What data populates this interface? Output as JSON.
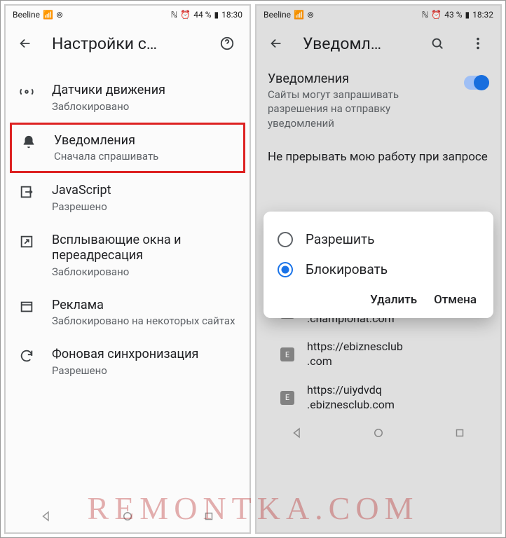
{
  "left": {
    "status": {
      "carrier": "Beeline",
      "battery": "44 %",
      "time": "18:30"
    },
    "appbar": {
      "title": "Настройки с…"
    },
    "items": [
      {
        "title": "Датчики движения",
        "sub": "Заблокировано"
      },
      {
        "title": "Уведомления",
        "sub": "Сначала спрашивать"
      },
      {
        "title": "JavaScript",
        "sub": "Разрешено"
      },
      {
        "title": "Всплывающие окна и переадресация",
        "sub": "Заблокировано"
      },
      {
        "title": "Реклама",
        "sub": "Заблокировано на некоторых сайтах"
      },
      {
        "title": "Фоновая синхронизация",
        "sub": "Разрешено"
      }
    ]
  },
  "right": {
    "status": {
      "carrier": "Beeline",
      "battery": "43 %",
      "time": "18:32"
    },
    "appbar": {
      "title": "Уведомл…"
    },
    "section": {
      "title": "Уведомления",
      "sub": "Сайты могут запрашивать разрешения на отправку уведомлений",
      "header2": "Не прерывать мою работу при запросе"
    },
    "dialog": {
      "opt_allow": "Разрешить",
      "opt_block": "Блокировать",
      "delete": "Удалить",
      "cancel": "Отмена"
    },
    "sites": [
      {
        "badge": "C",
        "url": "https://www\n.championat.com"
      },
      {
        "badge": "E",
        "url": "https://ebiznesclub\n.com"
      },
      {
        "badge": "E",
        "url": "https://uiydvdq\n.ebiznesclub.com"
      }
    ]
  },
  "watermark": "REMONTKA.COM"
}
